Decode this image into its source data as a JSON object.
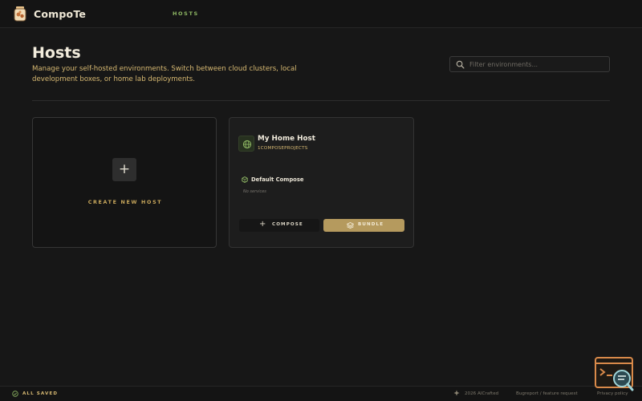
{
  "app": {
    "brand": "CompoTe",
    "nav": {
      "hosts": "HOSTS"
    }
  },
  "page": {
    "title": "Hosts",
    "description": "Manage your self-hosted environments. Switch between cloud clusters, local development boxes, or home lab deployments.",
    "search_placeholder": "Filter environments..."
  },
  "create_card": {
    "plus": "+",
    "label": "CREATE NEW HOST"
  },
  "host_card": {
    "name": "My Home Host",
    "projects": "1COMPOSEPROJECTS",
    "compose_name": "Default Compose",
    "compose_sub": "No services",
    "compose_button": "COMPOSE",
    "compose_button_icon": "+",
    "bundle_button": "BUNDLE"
  },
  "footer": {
    "saved": "ALL SAVED",
    "copyright": "2026 AICrafted",
    "feedback": "Bugreport / feature request",
    "privacy": "Privacy policy"
  },
  "colors": {
    "background": "#171717",
    "accent_gold": "#b59a5e",
    "accent_green": "#8fb864",
    "text_gold": "#d7b972"
  },
  "icons": {
    "logo": "jar-logo-icon",
    "search": "search-icon",
    "host": "globe-icon",
    "compose": "hexagon-icon",
    "bundle": "layers-icon",
    "saved": "check-circle-icon",
    "widget": "terminal-search-icon"
  }
}
